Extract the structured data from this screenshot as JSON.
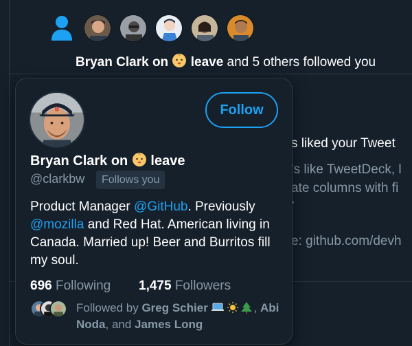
{
  "notification": {
    "icon": "person-follow-icon",
    "name": "Bryan Clark on",
    "name_suffix": "leave",
    "emoji": "baby-face-emoji",
    "rest": "and 5 others followed you",
    "avatar_count": 5
  },
  "background_tweet": {
    "liked_text": "s liked your Tweet",
    "line2": "'s like TweetDeck, l",
    "line3": "ate columns with fi",
    "line4": "e: github.com/devh"
  },
  "profile_card": {
    "name": "Bryan Clark on",
    "name_suffix": "leave",
    "handle": "@clarkbw",
    "follows_you": "Follows you",
    "follow_button": "Follow",
    "bio": {
      "part1": "Product Manager ",
      "mention1": "@GitHub",
      "part2": ". Previously ",
      "mention2": "@mozilla",
      "part3": " and Red Hat. American living in Canada. Married up! Beer and Burritos fill my soul."
    },
    "following_count": "696",
    "following_label": "Following",
    "followers_count": "1,475",
    "followers_label": "Followers",
    "followed_by_prefix": "Followed by ",
    "followed_by_name1": "Greg Schier",
    "followed_by_emoji": "laptop-sun-tree-emoji",
    "followed_by_sep": ",",
    "followed_by_name2": "Abi Noda",
    "followed_by_and": ", and ",
    "followed_by_name3": "James Long"
  },
  "colors": {
    "background": "#15202b",
    "accent": "#1da1f2",
    "secondary_text": "#8899a6"
  }
}
